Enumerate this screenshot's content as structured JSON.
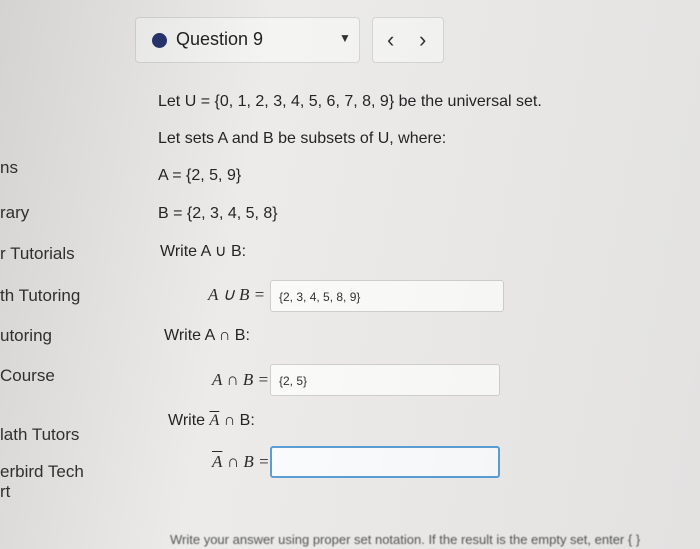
{
  "sidebar": {
    "items": [
      "ns",
      "rary",
      "r Tutorials",
      "th Tutoring",
      "utoring",
      "Course",
      "lath Tutors",
      "erbird Tech",
      "rt"
    ]
  },
  "question": {
    "title": "Question 9",
    "prev_icon": "chevron-left-icon",
    "next_icon": "chevron-right-icon",
    "caret_icon": "caret-down-icon",
    "dot_color": "#27346e"
  },
  "content": {
    "universal": "Let U = {0, 1, 2, 3, 4, 5, 6, 7, 8, 9} be the universal set.",
    "subsets": "Let sets A and B be subsets of U, where:",
    "set_a": "A = {2, 5, 9}",
    "set_b": "B = {2, 3, 4, 5, 8}",
    "prompt_union": "Write A ∪ B:",
    "union_label": "A ∪ B =",
    "union_value": "{2, 3, 4, 5, 8, 9}",
    "prompt_intersection": "Write A ∩ B:",
    "intersection_label": "A ∩ B =",
    "intersection_value": "{2, 5}",
    "prompt_complement_prefix": "Write",
    "complement_a": "A",
    "prompt_complement_suffix": "∩ B:",
    "complement_label_suffix": "∩ B =",
    "complement_value": ""
  },
  "footer": {
    "hint": "Write your answer using proper set notation. If the result is the empty set, enter { }"
  }
}
